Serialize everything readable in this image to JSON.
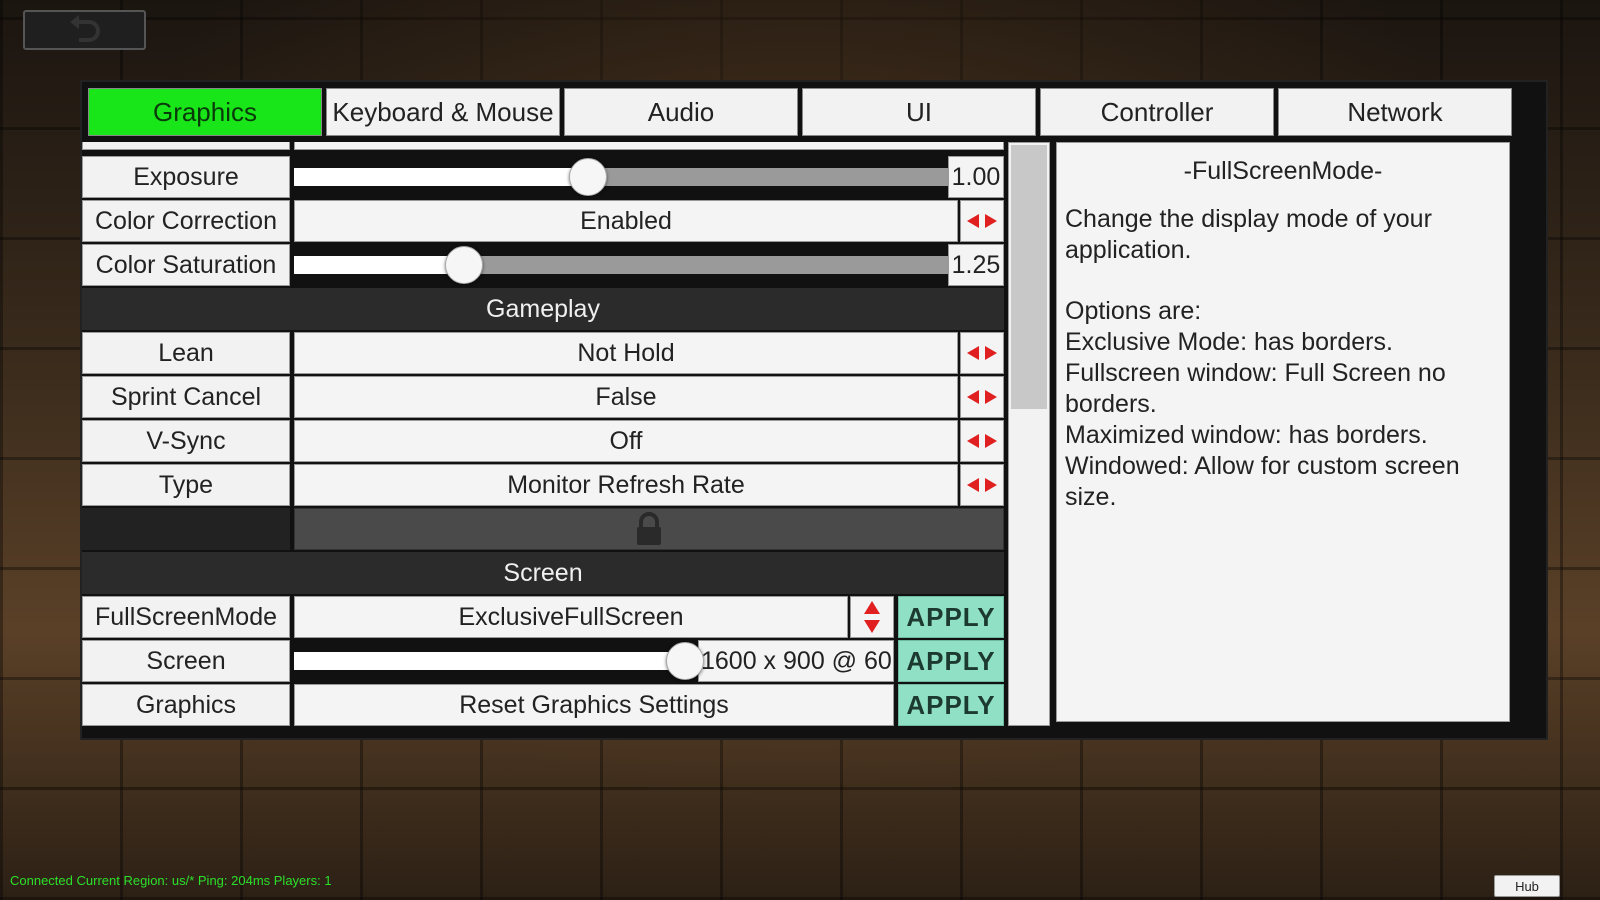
{
  "tabs": [
    "Graphics",
    "Keyboard & Mouse",
    "Audio",
    "UI",
    "Controller",
    "Network"
  ],
  "active_tab": "Graphics",
  "colors": {
    "active_tab": "#19e619",
    "apply_button": "#8fe0c4",
    "arrow": "#e02020",
    "status_text": "#2be02b"
  },
  "settings": {
    "exposure": {
      "label": "Exposure",
      "value": "1.00",
      "level": 0.45
    },
    "color_correction": {
      "label": "Color Correction",
      "value": "Enabled"
    },
    "color_saturation": {
      "label": "Color Saturation",
      "value": "1.25",
      "level": 0.26
    },
    "gameplay_header": "Gameplay",
    "lean": {
      "label": "Lean",
      "value": "Not Hold"
    },
    "sprint_cancel": {
      "label": "Sprint Cancel",
      "value": "False"
    },
    "vsync": {
      "label": "V-Sync",
      "value": "Off"
    },
    "type": {
      "label": "Type",
      "value": "Monitor Refresh Rate"
    },
    "screen_header": "Screen",
    "fullscreen_mode": {
      "label": "FullScreenMode",
      "value": "ExclusiveFullScreen",
      "apply": "APPLY"
    },
    "screen": {
      "label": "Screen",
      "value": "1600 x 900 @ 60",
      "apply": "APPLY"
    },
    "graphics": {
      "label": "Graphics",
      "value": "Reset Graphics Settings",
      "apply": "APPLY"
    }
  },
  "info": {
    "title": "-FullScreenMode-",
    "description": "Change the display mode of your application.",
    "options_heading": "Options are:",
    "options": [
      "Exclusive Mode:  has borders.",
      "Fullscreen window: Full Screen no borders.",
      "Maximized window: has borders.",
      "Windowed: Allow for custom screen size."
    ]
  },
  "status": "Connected Current Region: us/* Ping: 204ms Players: 1",
  "hub": "Hub",
  "icons": {
    "back": "undo-arrow-icon",
    "lock": "lock-icon",
    "arrows": "left-right-arrows-icon",
    "updown": "up-down-arrows-icon"
  }
}
